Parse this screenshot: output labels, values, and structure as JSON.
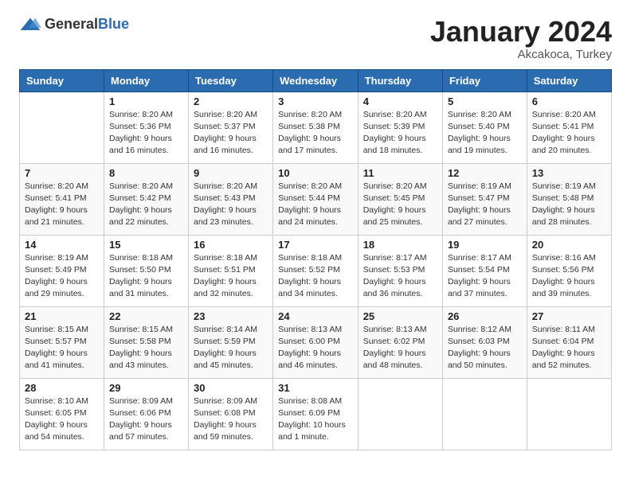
{
  "header": {
    "logo_general": "General",
    "logo_blue": "Blue",
    "month_year": "January 2024",
    "location": "Akcakoca, Turkey"
  },
  "days_of_week": [
    "Sunday",
    "Monday",
    "Tuesday",
    "Wednesday",
    "Thursday",
    "Friday",
    "Saturday"
  ],
  "weeks": [
    [
      {
        "day": "",
        "sunrise": "",
        "sunset": "",
        "daylight": ""
      },
      {
        "day": "1",
        "sunrise": "Sunrise: 8:20 AM",
        "sunset": "Sunset: 5:36 PM",
        "daylight": "Daylight: 9 hours and 16 minutes."
      },
      {
        "day": "2",
        "sunrise": "Sunrise: 8:20 AM",
        "sunset": "Sunset: 5:37 PM",
        "daylight": "Daylight: 9 hours and 16 minutes."
      },
      {
        "day": "3",
        "sunrise": "Sunrise: 8:20 AM",
        "sunset": "Sunset: 5:38 PM",
        "daylight": "Daylight: 9 hours and 17 minutes."
      },
      {
        "day": "4",
        "sunrise": "Sunrise: 8:20 AM",
        "sunset": "Sunset: 5:39 PM",
        "daylight": "Daylight: 9 hours and 18 minutes."
      },
      {
        "day": "5",
        "sunrise": "Sunrise: 8:20 AM",
        "sunset": "Sunset: 5:40 PM",
        "daylight": "Daylight: 9 hours and 19 minutes."
      },
      {
        "day": "6",
        "sunrise": "Sunrise: 8:20 AM",
        "sunset": "Sunset: 5:41 PM",
        "daylight": "Daylight: 9 hours and 20 minutes."
      }
    ],
    [
      {
        "day": "7",
        "sunrise": "Sunrise: 8:20 AM",
        "sunset": "Sunset: 5:41 PM",
        "daylight": "Daylight: 9 hours and 21 minutes."
      },
      {
        "day": "8",
        "sunrise": "Sunrise: 8:20 AM",
        "sunset": "Sunset: 5:42 PM",
        "daylight": "Daylight: 9 hours and 22 minutes."
      },
      {
        "day": "9",
        "sunrise": "Sunrise: 8:20 AM",
        "sunset": "Sunset: 5:43 PM",
        "daylight": "Daylight: 9 hours and 23 minutes."
      },
      {
        "day": "10",
        "sunrise": "Sunrise: 8:20 AM",
        "sunset": "Sunset: 5:44 PM",
        "daylight": "Daylight: 9 hours and 24 minutes."
      },
      {
        "day": "11",
        "sunrise": "Sunrise: 8:20 AM",
        "sunset": "Sunset: 5:45 PM",
        "daylight": "Daylight: 9 hours and 25 minutes."
      },
      {
        "day": "12",
        "sunrise": "Sunrise: 8:19 AM",
        "sunset": "Sunset: 5:47 PM",
        "daylight": "Daylight: 9 hours and 27 minutes."
      },
      {
        "day": "13",
        "sunrise": "Sunrise: 8:19 AM",
        "sunset": "Sunset: 5:48 PM",
        "daylight": "Daylight: 9 hours and 28 minutes."
      }
    ],
    [
      {
        "day": "14",
        "sunrise": "Sunrise: 8:19 AM",
        "sunset": "Sunset: 5:49 PM",
        "daylight": "Daylight: 9 hours and 29 minutes."
      },
      {
        "day": "15",
        "sunrise": "Sunrise: 8:18 AM",
        "sunset": "Sunset: 5:50 PM",
        "daylight": "Daylight: 9 hours and 31 minutes."
      },
      {
        "day": "16",
        "sunrise": "Sunrise: 8:18 AM",
        "sunset": "Sunset: 5:51 PM",
        "daylight": "Daylight: 9 hours and 32 minutes."
      },
      {
        "day": "17",
        "sunrise": "Sunrise: 8:18 AM",
        "sunset": "Sunset: 5:52 PM",
        "daylight": "Daylight: 9 hours and 34 minutes."
      },
      {
        "day": "18",
        "sunrise": "Sunrise: 8:17 AM",
        "sunset": "Sunset: 5:53 PM",
        "daylight": "Daylight: 9 hours and 36 minutes."
      },
      {
        "day": "19",
        "sunrise": "Sunrise: 8:17 AM",
        "sunset": "Sunset: 5:54 PM",
        "daylight": "Daylight: 9 hours and 37 minutes."
      },
      {
        "day": "20",
        "sunrise": "Sunrise: 8:16 AM",
        "sunset": "Sunset: 5:56 PM",
        "daylight": "Daylight: 9 hours and 39 minutes."
      }
    ],
    [
      {
        "day": "21",
        "sunrise": "Sunrise: 8:15 AM",
        "sunset": "Sunset: 5:57 PM",
        "daylight": "Daylight: 9 hours and 41 minutes."
      },
      {
        "day": "22",
        "sunrise": "Sunrise: 8:15 AM",
        "sunset": "Sunset: 5:58 PM",
        "daylight": "Daylight: 9 hours and 43 minutes."
      },
      {
        "day": "23",
        "sunrise": "Sunrise: 8:14 AM",
        "sunset": "Sunset: 5:59 PM",
        "daylight": "Daylight: 9 hours and 45 minutes."
      },
      {
        "day": "24",
        "sunrise": "Sunrise: 8:13 AM",
        "sunset": "Sunset: 6:00 PM",
        "daylight": "Daylight: 9 hours and 46 minutes."
      },
      {
        "day": "25",
        "sunrise": "Sunrise: 8:13 AM",
        "sunset": "Sunset: 6:02 PM",
        "daylight": "Daylight: 9 hours and 48 minutes."
      },
      {
        "day": "26",
        "sunrise": "Sunrise: 8:12 AM",
        "sunset": "Sunset: 6:03 PM",
        "daylight": "Daylight: 9 hours and 50 minutes."
      },
      {
        "day": "27",
        "sunrise": "Sunrise: 8:11 AM",
        "sunset": "Sunset: 6:04 PM",
        "daylight": "Daylight: 9 hours and 52 minutes."
      }
    ],
    [
      {
        "day": "28",
        "sunrise": "Sunrise: 8:10 AM",
        "sunset": "Sunset: 6:05 PM",
        "daylight": "Daylight: 9 hours and 54 minutes."
      },
      {
        "day": "29",
        "sunrise": "Sunrise: 8:09 AM",
        "sunset": "Sunset: 6:06 PM",
        "daylight": "Daylight: 9 hours and 57 minutes."
      },
      {
        "day": "30",
        "sunrise": "Sunrise: 8:09 AM",
        "sunset": "Sunset: 6:08 PM",
        "daylight": "Daylight: 9 hours and 59 minutes."
      },
      {
        "day": "31",
        "sunrise": "Sunrise: 8:08 AM",
        "sunset": "Sunset: 6:09 PM",
        "daylight": "Daylight: 10 hours and 1 minute."
      },
      {
        "day": "",
        "sunrise": "",
        "sunset": "",
        "daylight": ""
      },
      {
        "day": "",
        "sunrise": "",
        "sunset": "",
        "daylight": ""
      },
      {
        "day": "",
        "sunrise": "",
        "sunset": "",
        "daylight": ""
      }
    ]
  ]
}
